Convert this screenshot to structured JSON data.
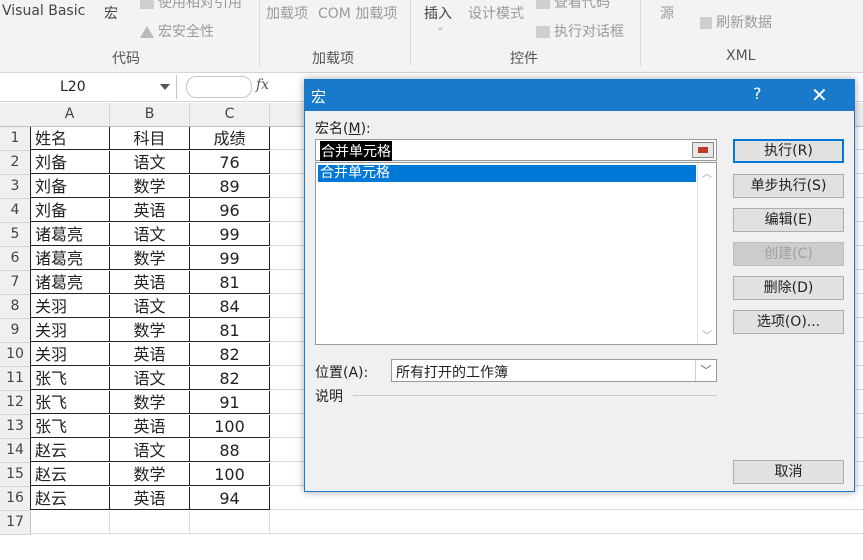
{
  "ribbon": {
    "visual_basic": "Visual Basic",
    "macros": "宏",
    "use_relative": "使用相对引用",
    "macro_security": "宏安全性",
    "addins": "加载项",
    "com_addins": "COM 加载项",
    "insert": "插入",
    "design_mode": "设计模式",
    "view_code": "查看代码",
    "run_dialog": "执行对话框",
    "source": "源",
    "refresh_data": "刷新数据",
    "groups": {
      "code": "代码",
      "addins": "加载项",
      "controls": "控件",
      "xml": "XML"
    }
  },
  "formula_bar": {
    "name_box": "L20",
    "fx": "fx"
  },
  "sheet": {
    "columns": [
      "A",
      "B",
      "C"
    ],
    "rows": [
      [
        "姓名",
        "科目",
        "成绩"
      ],
      [
        "刘备",
        "语文",
        "76"
      ],
      [
        "刘备",
        "数学",
        "89"
      ],
      [
        "刘备",
        "英语",
        "96"
      ],
      [
        "诸葛亮",
        "语文",
        "99"
      ],
      [
        "诸葛亮",
        "数学",
        "99"
      ],
      [
        "诸葛亮",
        "英语",
        "81"
      ],
      [
        "关羽",
        "语文",
        "84"
      ],
      [
        "关羽",
        "数学",
        "81"
      ],
      [
        "关羽",
        "英语",
        "82"
      ],
      [
        "张飞",
        "语文",
        "82"
      ],
      [
        "张飞",
        "数学",
        "91"
      ],
      [
        "张飞",
        "英语",
        "100"
      ],
      [
        "赵云",
        "语文",
        "88"
      ],
      [
        "赵云",
        "数学",
        "100"
      ],
      [
        "赵云",
        "英语",
        "94"
      ]
    ],
    "row_numbers": [
      "1",
      "2",
      "3",
      "4",
      "5",
      "6",
      "7",
      "8",
      "9",
      "10",
      "11",
      "12",
      "13",
      "14",
      "15",
      "16",
      "17"
    ]
  },
  "dialog": {
    "title": "宏",
    "help": "?",
    "close": "✕",
    "macro_name_label": "宏名(",
    "macro_name_key": "M",
    "macro_name_label_end": "):",
    "macro_name_value": "合并单元格",
    "macro_list": [
      "合并单元格"
    ],
    "buttons": {
      "run": "执行(R)",
      "step_into": "单步执行(S)",
      "edit": "编辑(E)",
      "create": "创建(C)",
      "delete": "删除(D)",
      "options": "选项(O)...",
      "cancel": "取消"
    },
    "location_label": "位置(A):",
    "location_value": "所有打开的工作簿",
    "description_label": "说明"
  },
  "colors": {
    "accent": "#1979ca",
    "selection": "#0078d7"
  }
}
